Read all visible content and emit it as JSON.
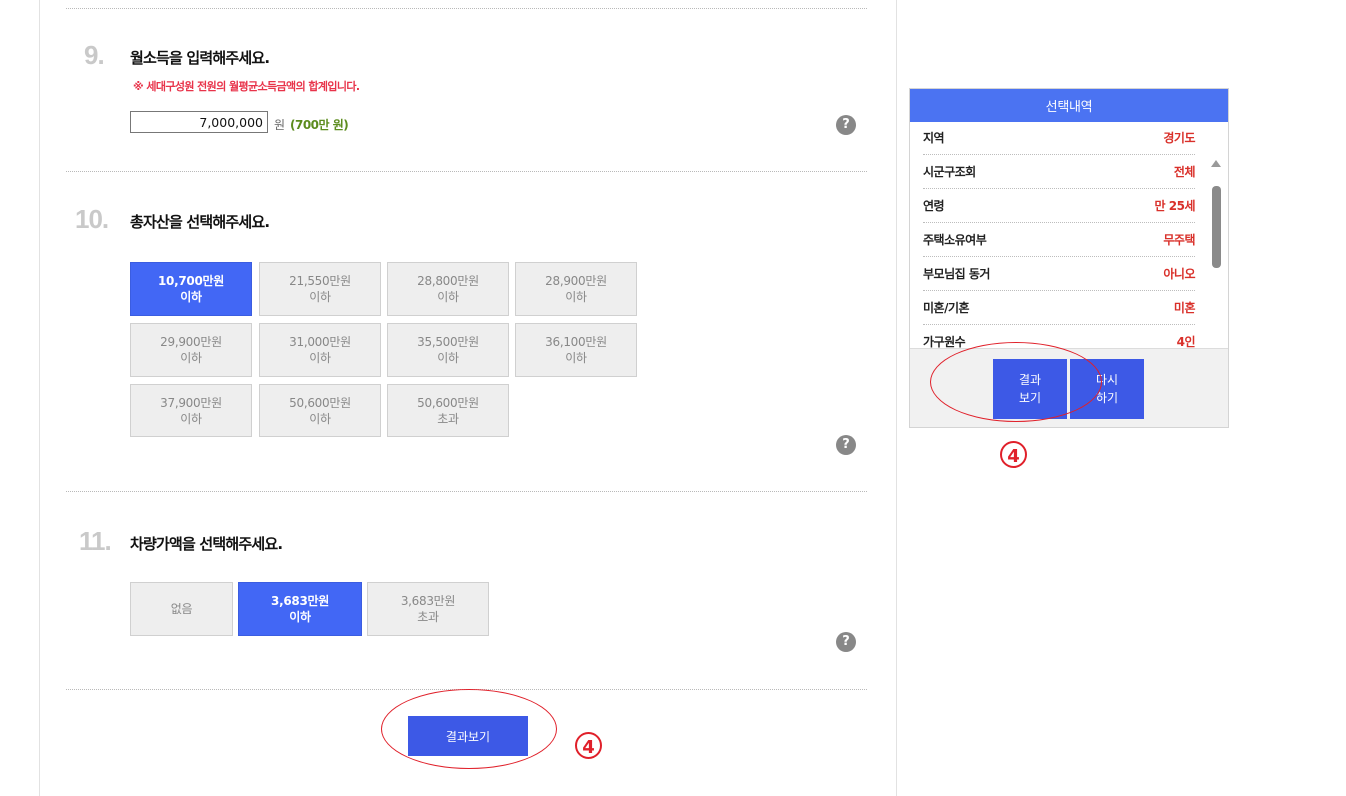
{
  "q9": {
    "number": "9.",
    "title": "월소득을 입력해주세요.",
    "note": "※ 세대구성원 전원의 월평균소득금액의 합계입니다.",
    "income_value": "7,000,000",
    "unit": "원",
    "man_won": "(700만 원)"
  },
  "q10": {
    "number": "10.",
    "title": "총자산을 선택해주세요.",
    "options": [
      {
        "line1": "10,700만원",
        "line2": "이하",
        "selected": true
      },
      {
        "line1": "21,550만원",
        "line2": "이하",
        "selected": false
      },
      {
        "line1": "28,800만원",
        "line2": "이하",
        "selected": false
      },
      {
        "line1": "28,900만원",
        "line2": "이하",
        "selected": false
      },
      {
        "line1": "29,900만원",
        "line2": "이하",
        "selected": false
      },
      {
        "line1": "31,000만원",
        "line2": "이하",
        "selected": false
      },
      {
        "line1": "35,500만원",
        "line2": "이하",
        "selected": false
      },
      {
        "line1": "36,100만원",
        "line2": "이하",
        "selected": false
      },
      {
        "line1": "37,900만원",
        "line2": "이하",
        "selected": false
      },
      {
        "line1": "50,600만원",
        "line2": "이하",
        "selected": false
      },
      {
        "line1": "50,600만원",
        "line2": "초과",
        "selected": false
      }
    ]
  },
  "q11": {
    "number": "11.",
    "title": "차량가액을 선택해주세요.",
    "options": [
      {
        "line1": "없음",
        "line2": "",
        "selected": false
      },
      {
        "line1": "3,683만원",
        "line2": "이하",
        "selected": true
      },
      {
        "line1": "3,683만원",
        "line2": "초과",
        "selected": false
      }
    ]
  },
  "help_glyph": "?",
  "result_button": "결과보기",
  "annotation_number": "4",
  "summary": {
    "title": "선택내역",
    "rows": [
      {
        "key": "지역",
        "value": "경기도"
      },
      {
        "key": "시군구조회",
        "value": "전체"
      },
      {
        "key": "연령",
        "value": "만 25세"
      },
      {
        "key": "주택소유여부",
        "value": "무주택"
      },
      {
        "key": "부모님집 동거",
        "value": "아니오"
      },
      {
        "key": "미혼/기혼",
        "value": "미혼"
      },
      {
        "key": "가구원수",
        "value": "4인"
      }
    ],
    "result_btn": {
      "line1": "결과",
      "line2": "보기"
    },
    "reset_btn": {
      "line1": "다시",
      "line2": "하기"
    }
  },
  "colors": {
    "accent_blue": "#4267f5",
    "annotation_red": "#e0202a",
    "value_red": "#d9302a",
    "note_red": "#e8334a",
    "man_green": "#5c8c1e"
  },
  "icons": [
    "help-icon",
    "scroll-up-icon",
    "scroll-down-icon"
  ]
}
